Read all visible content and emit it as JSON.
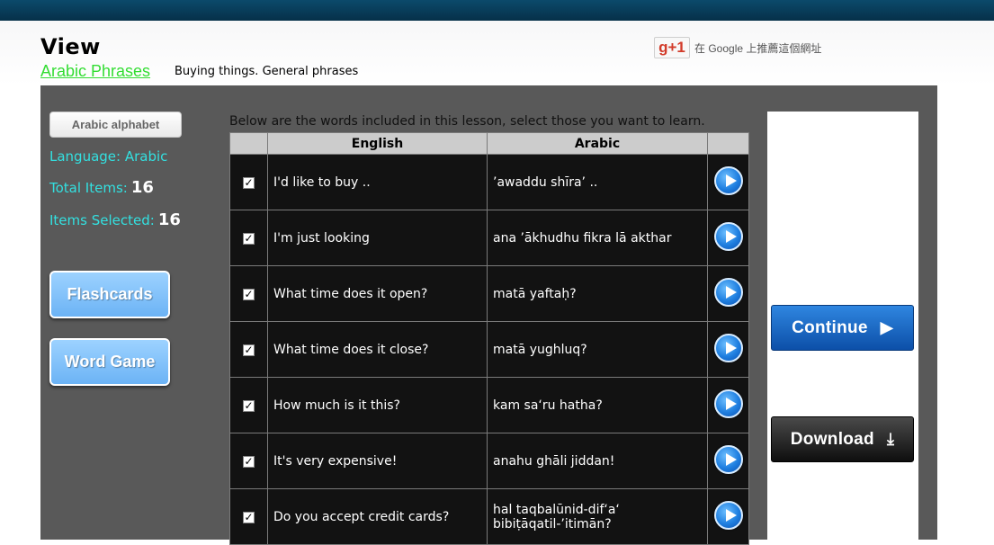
{
  "header": {
    "title": "View",
    "crumb_link": "Arabic Phrases",
    "crumb_sub": "Buying things. General phrases",
    "gplus_label": "g+1",
    "gplus_text": "在 Google 上推薦這個網址"
  },
  "sidebar": {
    "alphabet_button": "Arabic alphabet",
    "language_label": "Language: Arabic",
    "total_label": "Total Items:",
    "total_value": "16",
    "selected_label": "Items Selected:",
    "selected_value": "16",
    "flashcards_button": "Flashcards",
    "wordgame_button": "Word Game"
  },
  "lesson": {
    "instruction": "Below are the words included in this lesson, select those you want to learn.",
    "columns": [
      "English",
      "Arabic"
    ],
    "rows": [
      {
        "english": "I'd like to buy ..",
        "arabic": "’awaddu shīra’ ..",
        "checked": true
      },
      {
        "english": "I'm just looking",
        "arabic": "ana ’ākhudhu fikra lā akthar",
        "checked": true
      },
      {
        "english": "What time does it open?",
        "arabic": "matā yaftaḥ?",
        "checked": true
      },
      {
        "english": "What time does it close?",
        "arabic": "matā yughluq?",
        "checked": true
      },
      {
        "english": "How much is it this?",
        "arabic": "kam sa‘ru hatha?",
        "checked": true
      },
      {
        "english": "It's very expensive!",
        "arabic": "anahu ghāli jiddan!",
        "checked": true
      },
      {
        "english": "Do you accept credit cards?",
        "arabic": "hal taqbalūnid-dif‘a‘ bibiṭāqatil-’itimān?",
        "checked": true
      }
    ]
  },
  "actions": {
    "continue_label": "Continue",
    "download_label": "Download"
  },
  "colors": {
    "panel": "#595959",
    "accent_cyan": "#33e0e0",
    "link_green": "#33dd33",
    "continue_blue": "#1e6cc8"
  }
}
